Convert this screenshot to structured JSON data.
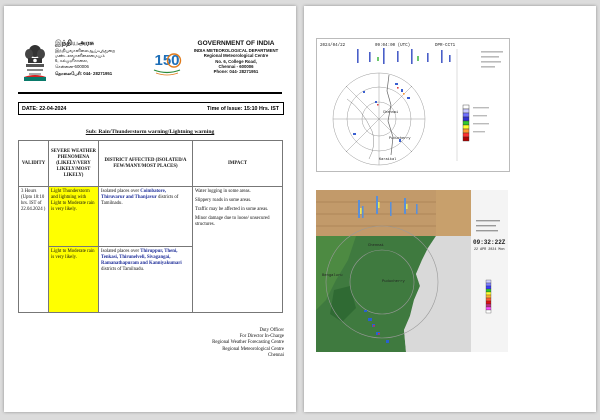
{
  "header": {
    "tamil_org": "இந்தியஅரசு",
    "tamil_lines": [
      "இந்தியவானிலைஆய்வுத்துறை",
      "மண்டலவானிலைமையம்",
      "6, கல்லூரிசாலை,",
      "சென்னை-600006"
    ],
    "tamil_phone": "தொலைபேசி: 044- 28271951",
    "org": "GOVERNMENT OF INDIA",
    "dept": "INDIA METEOROLOGICAL DEPARTMENT",
    "centre": "Regional Meteorological Centre",
    "address": "No. 6, College Road,",
    "city": "Chennai - 600006",
    "phone": "Phone: 044- 28271951",
    "logo_text": "150"
  },
  "issue": {
    "date": "DATE: 22-04-2024",
    "time": "Time of Issue: 15:10 Hrs. IST"
  },
  "warning_title": "Sub: Rain/Thunderstorm warning/Lightning warning",
  "table": {
    "headers": [
      "VALIDITY",
      "SEVERE WEATHER PHENOMENA (LIKELY/VERY LIKELY/MOST LIKELY)",
      "DISTRICT AFFECTED (ISOLATED/A FEW/MANY/MOST PLACES)",
      "IMPACT"
    ],
    "validity": "3 Hours (Upto 18:10 hrs. IST of 22.04.2024 )",
    "row1": {
      "phenomena": "Light Thunderstorm and lightning with Light to Moderate rain is very likely.",
      "prefix": "Isolated places over",
      "places": "Coimbatore, Thiruvarur and Thanjavur",
      "suffix": "districts of Tamilnadu."
    },
    "row2": {
      "phenomena": "Light to Moderate rain is very likely.",
      "prefix": "Isolated places over",
      "places": "Thiruppur, Theni, Tenkasi, Thirunelveli, Sivagangai, Ramanathapuram and Kanniyakumari",
      "suffix": "districts of Tamilnadu."
    },
    "impact": [
      "Water logging in some areas.",
      "Slippery roads in some areas.",
      "Traffic may be affected in some areas.",
      "Minor damage due to loose/ unsecured structures."
    ]
  },
  "signature": [
    "Duty Officer",
    "For Director In-Charge",
    "Regional Weather Forecasting Centre",
    "Regional Meteorological Centre",
    "Chennai"
  ],
  "radar1": {
    "date": "2024/04/22",
    "time": "09:04:00 (UTC)",
    "code": "DPR-CC71",
    "labels": [
      "Chennai",
      "Karaikal",
      "Puducherry"
    ]
  },
  "radar2": {
    "time": "09:32:22Z",
    "date": "22 APR 2024 Mon",
    "labels": [
      "Bengaluru",
      "Chennai",
      "Puducherry"
    ]
  }
}
